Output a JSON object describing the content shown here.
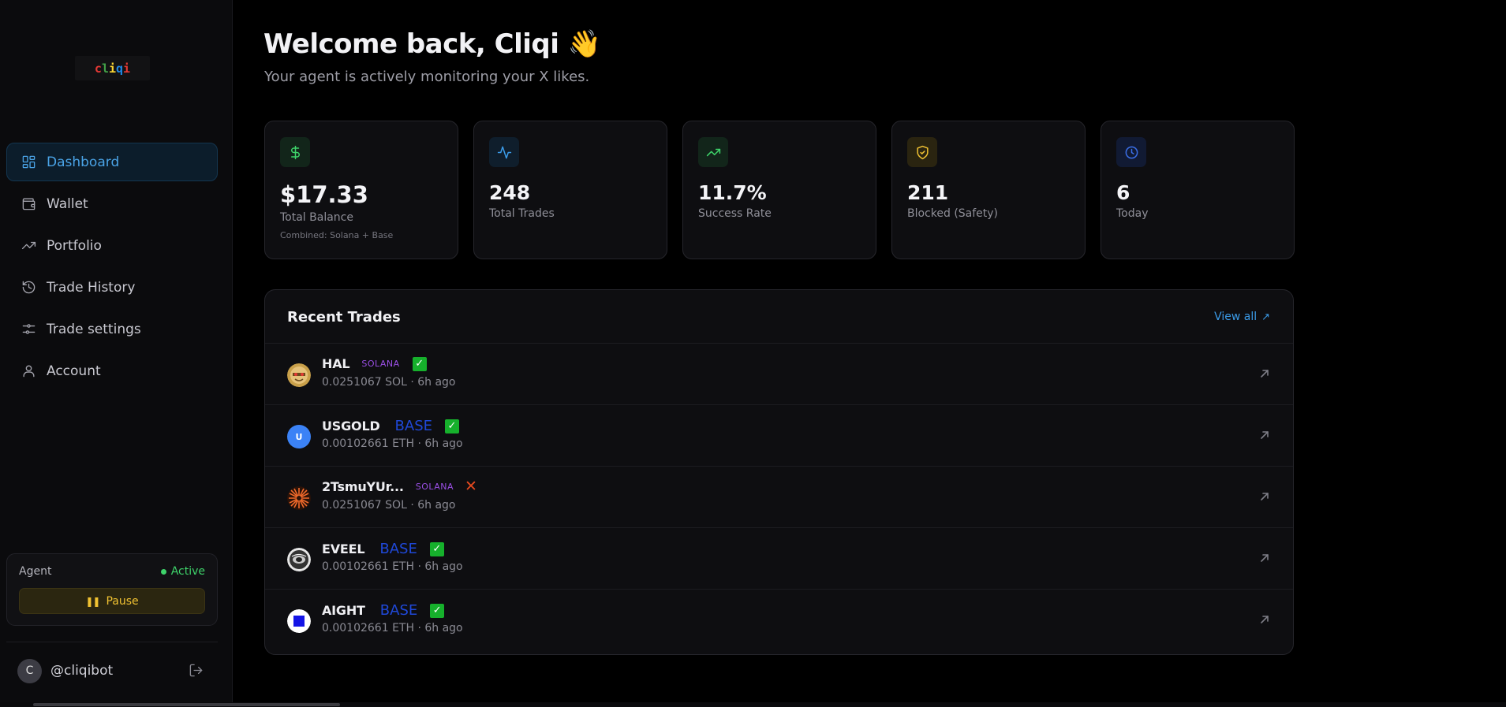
{
  "app": {
    "logo_text": "cliqi",
    "logo_colors": [
      "#e53935",
      "#43a047",
      "#1e88e5",
      "#fdd835",
      "#8e24aa"
    ]
  },
  "sidebar": {
    "items": [
      {
        "label": "Dashboard",
        "icon": "dashboard-icon",
        "active": true
      },
      {
        "label": "Wallet",
        "icon": "wallet-icon",
        "active": false
      },
      {
        "label": "Portfolio",
        "icon": "trending-up-icon",
        "active": false
      },
      {
        "label": "Trade History",
        "icon": "history-icon",
        "active": false
      },
      {
        "label": "Trade settings",
        "icon": "sliders-icon",
        "active": false
      },
      {
        "label": "Account",
        "icon": "user-icon",
        "active": false
      }
    ],
    "agent": {
      "label": "Agent",
      "status": "Active",
      "pause_label": "Pause"
    },
    "user": {
      "initial": "C",
      "handle": "@cliqibot"
    }
  },
  "header": {
    "title": "Welcome back, Cliqi 👋",
    "subtitle": "Your agent is actively monitoring your X likes."
  },
  "stats": [
    {
      "value": "$17.33",
      "label": "Total Balance",
      "note": "Combined: Solana + Base",
      "icon": "dollar-icon",
      "color": "#3ed36a"
    },
    {
      "value": "248",
      "label": "Total Trades",
      "icon": "activity-icon",
      "color": "#3b9be8"
    },
    {
      "value": "11.7%",
      "label": "Success Rate",
      "icon": "trending-up-icon",
      "color": "#3ed36a"
    },
    {
      "value": "211",
      "label": "Blocked (Safety)",
      "icon": "shield-icon",
      "color": "#f1c232"
    },
    {
      "value": "6",
      "label": "Today",
      "icon": "clock-icon",
      "color": "#3b6fe8"
    }
  ],
  "recent_trades": {
    "title": "Recent Trades",
    "view_all": "View all",
    "rows": [
      {
        "name": "HAL",
        "chain": "SOLANA",
        "status": "success",
        "detail": "0.0251067 SOL · 6h ago",
        "token_icon": "hal-token-icon"
      },
      {
        "name": "USGOLD",
        "chain": "BASE",
        "status": "success",
        "detail": "0.00102661 ETH · 6h ago",
        "token_icon": "usgold-token-icon",
        "token_letter": "U"
      },
      {
        "name": "2TsmuYUr...",
        "chain": "SOLANA",
        "status": "failed",
        "detail": "0.0251067 SOL · 6h ago",
        "token_icon": "2tsmu-token-icon"
      },
      {
        "name": "EVEEL",
        "chain": "BASE",
        "status": "success",
        "detail": "0.00102661 ETH · 6h ago",
        "token_icon": "eveel-token-icon"
      },
      {
        "name": "AIGHT",
        "chain": "BASE",
        "status": "success",
        "detail": "0.00102661 ETH · 6h ago",
        "token_icon": "aight-token-icon"
      }
    ]
  },
  "symbols": {
    "check": "✓",
    "cross": "✕",
    "pause": "❚❚"
  }
}
